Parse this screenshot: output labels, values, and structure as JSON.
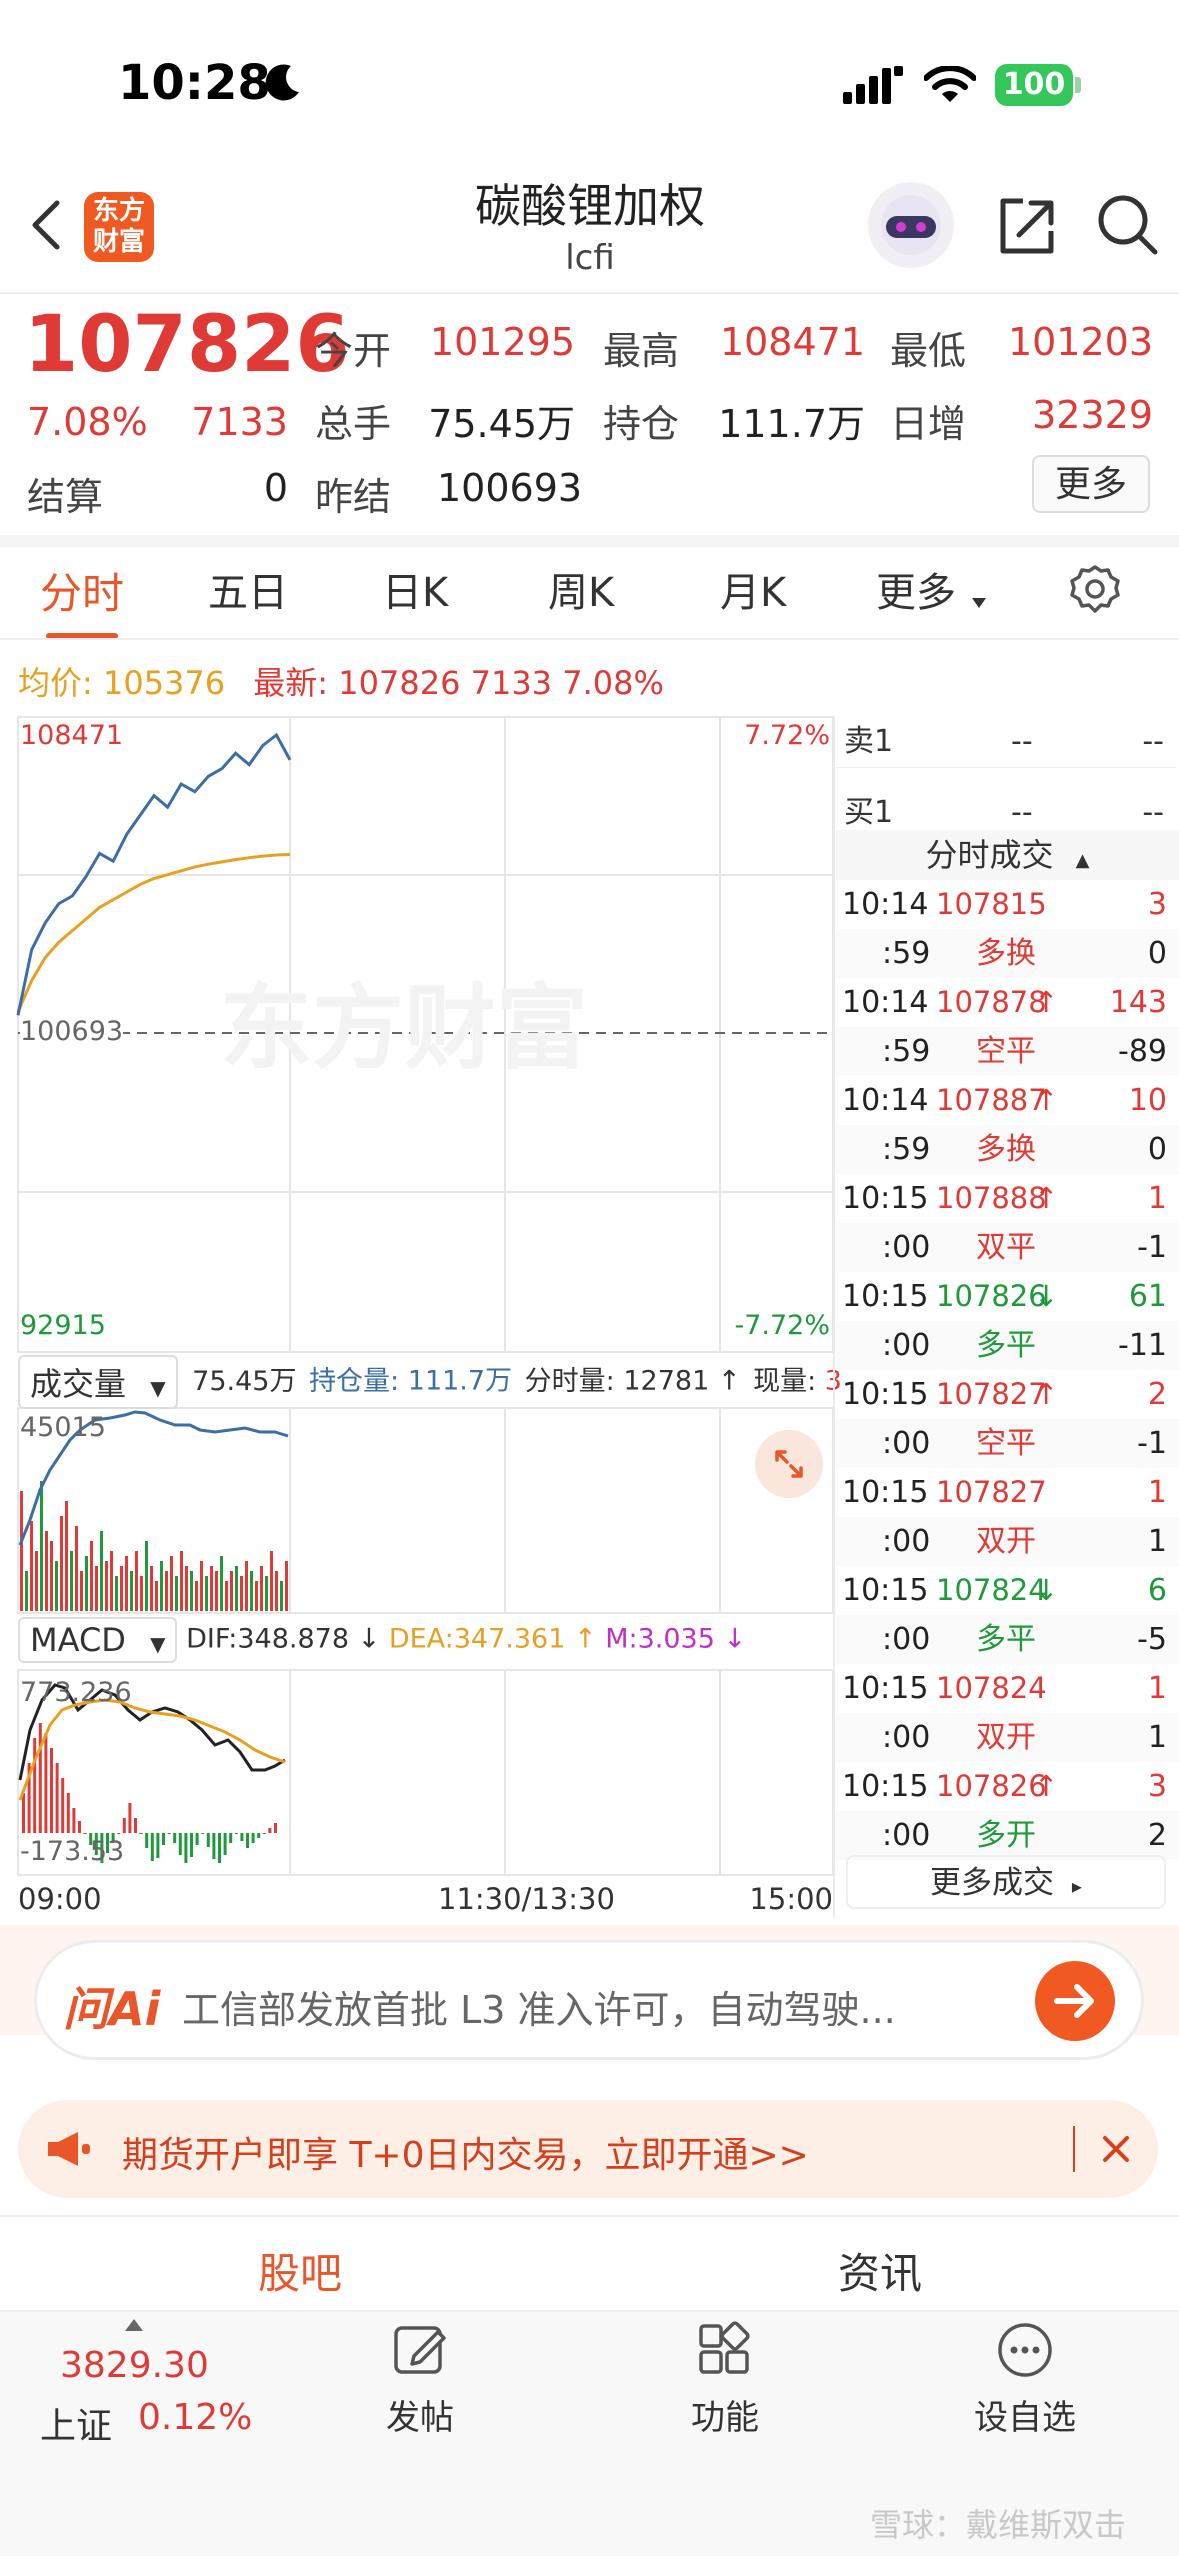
{
  "status": {
    "time": "10:28",
    "battery": "100"
  },
  "header": {
    "title": "碳酸锂加权",
    "subtitle": "lcfi",
    "logo_text": "东方财富"
  },
  "quote": {
    "price": "107826",
    "change_pct": "7.08%",
    "change": "7133",
    "open_label": "今开",
    "open": "101295",
    "high_label": "最高",
    "high": "108471",
    "low_label": "最低",
    "low": "101203",
    "volume_label": "总手",
    "volume": "75.45万",
    "oi_label": "持仓",
    "oi": "111.7万",
    "daily_inc_label": "日增",
    "daily_inc": "32329",
    "settle_label": "结算",
    "settle": "0",
    "prev_settle_label": "昨结",
    "prev_settle": "100693",
    "more_label": "更多"
  },
  "tabs": [
    "分时",
    "五日",
    "日K",
    "周K",
    "月K",
    "更多"
  ],
  "info_line": {
    "avg_label": "均价:",
    "avg": "105376",
    "latest_label": "最新:",
    "latest": "107826",
    "change": "7133",
    "pct": "7.08%"
  },
  "chart": {
    "high_label": "108471",
    "high_pct": "7.72%",
    "mid_label": "100693",
    "low_label": "92915",
    "low_pct": "-7.72%",
    "watermark": "东方财富",
    "time_start": "09:00",
    "time_mid": "11:30/13:30",
    "time_end": "15:00",
    "vol_selector": "成交量",
    "vol_total": "75.45万",
    "oi_label": "持仓量:",
    "oi": "111.7万",
    "min_vol_label": "分时量:",
    "min_vol": "12781",
    "cur_label": "现量:",
    "cur": "3",
    "vol_max": "45015",
    "macd_selector": "MACD",
    "dif": "DIF:348.878",
    "dea": "DEA:347.361",
    "m": "M:3.035",
    "macd_high": "773.236",
    "macd_low": "-173.53"
  },
  "chart_data": {
    "type": "line",
    "y_range": [
      92915,
      108471
    ],
    "y_ticks": [
      "108471",
      "100693",
      "92915"
    ],
    "x_ticks": [
      "09:00",
      "11:30/13:30",
      "15:00"
    ],
    "series": [
      {
        "name": "最新",
        "values": [
          101203,
          102900,
          103600,
          104100,
          104300,
          104800,
          105400,
          105200,
          105900,
          106400,
          106900,
          106600,
          107200,
          107000,
          107400,
          107600,
          108000,
          107700,
          108200,
          108471,
          107826
        ]
      },
      {
        "name": "均价",
        "values": [
          101295,
          102100,
          102700,
          103100,
          103400,
          103700,
          104000,
          104200,
          104400,
          104600,
          104750,
          104850,
          104950,
          105050,
          105120,
          105180,
          105240,
          105290,
          105330,
          105360,
          105376
        ]
      }
    ]
  },
  "order_book": [
    {
      "label": "卖1",
      "price": "--",
      "qty": "--"
    },
    {
      "label": "买1",
      "price": "--",
      "qty": "--"
    }
  ],
  "trades_header": "分时成交",
  "trades": [
    {
      "time": "10:14",
      "price": "107815",
      "arrow": "",
      "vol": "3",
      "sub": ":59",
      "type": "多换",
      "oi": "0"
    },
    {
      "time": "10:14",
      "price": "107878",
      "arrow": "↑",
      "vol": "143",
      "sub": ":59",
      "type": "空平",
      "oi": "-89"
    },
    {
      "time": "10:14",
      "price": "107887",
      "arrow": "↑",
      "vol": "10",
      "sub": ":59",
      "type": "多换",
      "oi": "0"
    },
    {
      "time": "10:15",
      "price": "107888",
      "arrow": "↑",
      "vol": "1",
      "sub": ":00",
      "type": "双平",
      "oi": "-1"
    },
    {
      "time": "10:15",
      "price": "107826",
      "arrow": "↓",
      "vol": "61",
      "sub": ":00",
      "type": "多平",
      "oi": "-11"
    },
    {
      "time": "10:15",
      "price": "107827",
      "arrow": "↑",
      "vol": "2",
      "sub": ":00",
      "type": "空平",
      "oi": "-1"
    },
    {
      "time": "10:15",
      "price": "107827",
      "arrow": "",
      "vol": "1",
      "sub": ":00",
      "type": "双开",
      "oi": "1"
    },
    {
      "time": "10:15",
      "price": "107824",
      "arrow": "↓",
      "vol": "6",
      "sub": ":00",
      "type": "多平",
      "oi": "-5"
    },
    {
      "time": "10:15",
      "price": "107824",
      "arrow": "",
      "vol": "1",
      "sub": ":00",
      "type": "双开",
      "oi": "1"
    },
    {
      "time": "10:15",
      "price": "107826",
      "arrow": "↑",
      "vol": "3",
      "sub": ":00",
      "type": "多开",
      "oi": "2"
    }
  ],
  "more_trades": "更多成交",
  "ai_bar": {
    "brand": "问Ai",
    "text": "工信部发放首批 L3 准入许可，自动驾驶..."
  },
  "promo": {
    "text": "期货开户即享 T+0日内交易，立即开通>>"
  },
  "section_tabs": [
    "股吧",
    "资讯"
  ],
  "bottom_bar": {
    "index_value": "3829.30",
    "index_name": "上证",
    "index_pct": "0.12%",
    "post": "发帖",
    "func": "功能",
    "watch": "设自选"
  },
  "watermark": "雪球：戴维斯双击",
  "colors": {
    "up": "#e03a36",
    "down": "#1f9a3a",
    "accent": "#f05a22",
    "avg_line": "#e8a020",
    "price_line": "#3a6ea5"
  }
}
